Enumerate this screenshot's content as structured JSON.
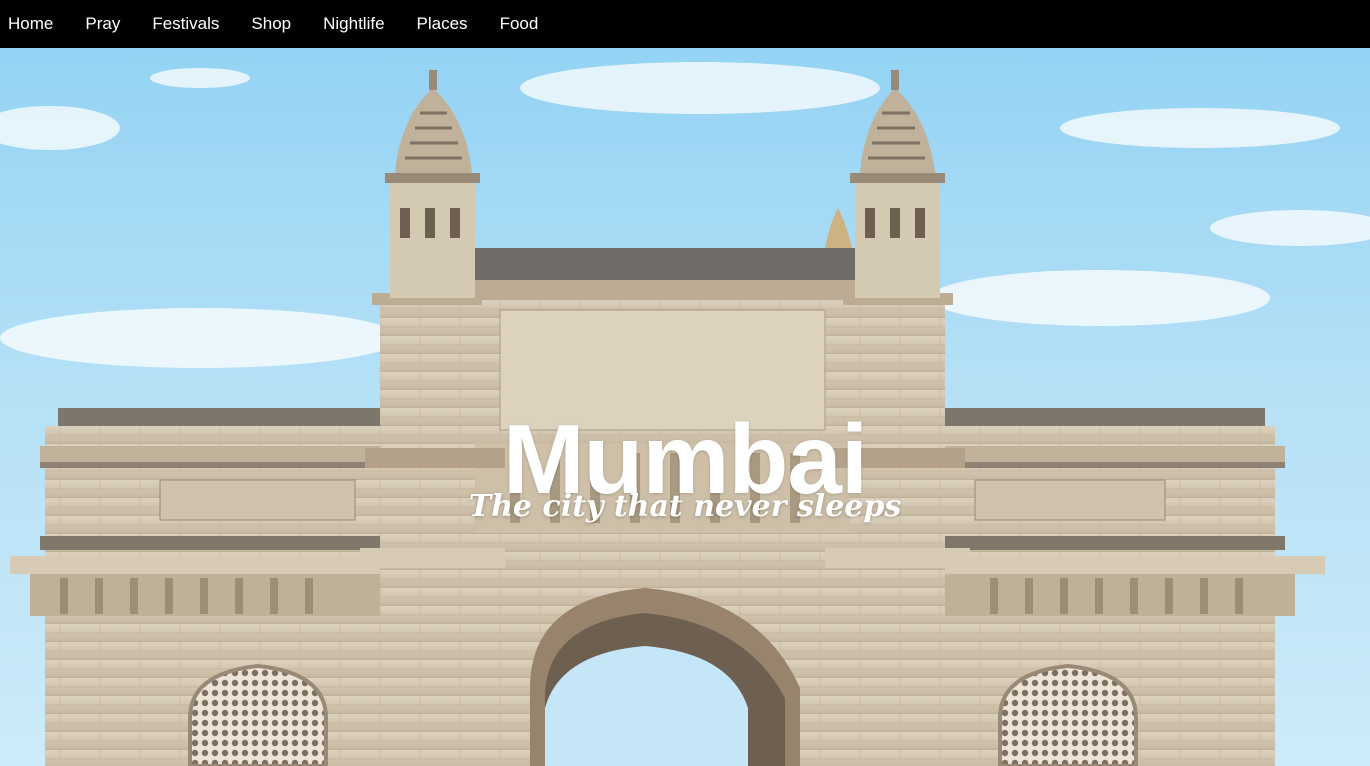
{
  "nav": {
    "items": [
      {
        "label": "Home"
      },
      {
        "label": "Pray"
      },
      {
        "label": "Festivals"
      },
      {
        "label": "Shop"
      },
      {
        "label": "Nightlife"
      },
      {
        "label": "Places"
      },
      {
        "label": "Food"
      }
    ]
  },
  "hero": {
    "title": "Mumbai",
    "subtitle": "The city that never sleeps",
    "image": "gateway-of-india-photo"
  },
  "colors": {
    "navbar_bg": "#000000",
    "nav_text": "#ffffff",
    "sky": "#8fd0f0",
    "stone": "#cdbfa8"
  }
}
